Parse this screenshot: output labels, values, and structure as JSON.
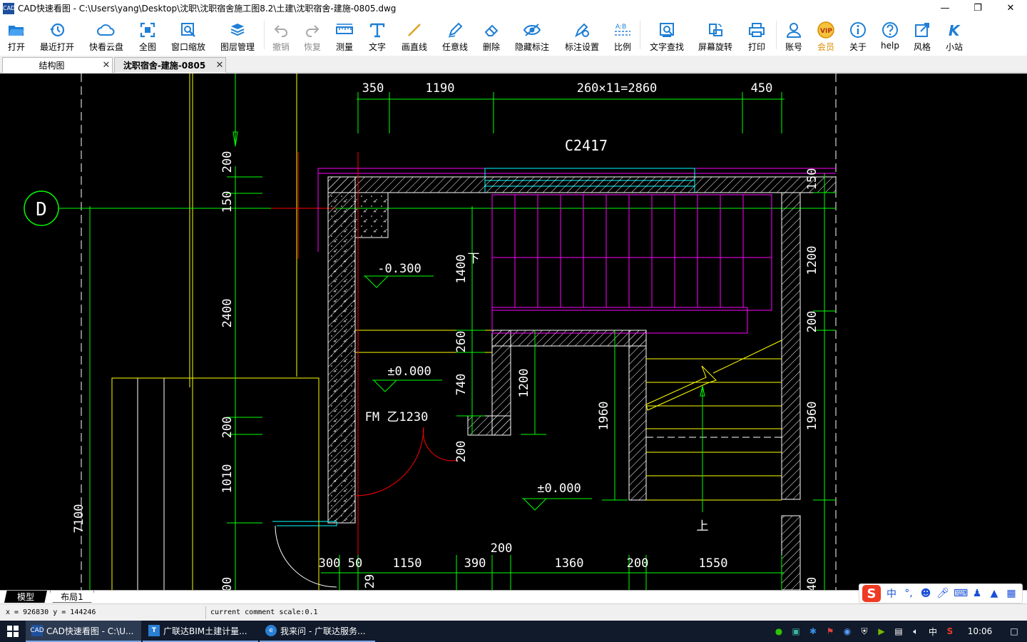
{
  "window": {
    "title": "CAD快速看图 - C:\\Users\\yang\\Desktop\\沈职\\沈职宿舍施工图8.2\\土建\\沈职宿舍-建施-0805.dwg",
    "icon": "cad-app-icon"
  },
  "toolbar": [
    {
      "label": "打开",
      "icon": "folder-open-icon"
    },
    {
      "label": "最近打开",
      "icon": "history-icon"
    },
    {
      "label": "快看云盘",
      "icon": "cloud-icon"
    },
    {
      "label": "全图",
      "icon": "fit-all-icon"
    },
    {
      "label": "窗口缩放",
      "icon": "zoom-window-icon"
    },
    {
      "label": "图层管理",
      "icon": "layers-icon"
    },
    {
      "label": "撤销",
      "icon": "undo-icon",
      "disabled": true
    },
    {
      "label": "恢复",
      "icon": "redo-icon",
      "disabled": true
    },
    {
      "label": "测量",
      "icon": "ruler-icon"
    },
    {
      "label": "文字",
      "icon": "text-icon"
    },
    {
      "label": "画直线",
      "icon": "line-icon"
    },
    {
      "label": "任意线",
      "icon": "pen-icon"
    },
    {
      "label": "删除",
      "icon": "eraser-icon"
    },
    {
      "label": "隐藏标注",
      "icon": "eye-hide-icon"
    },
    {
      "label": "标注设置",
      "icon": "annotation-settings-icon"
    },
    {
      "label": "比例",
      "icon": "scale-icon"
    },
    {
      "label": "文字查找",
      "icon": "text-search-icon"
    },
    {
      "label": "屏幕旋转",
      "icon": "rotate-screen-icon"
    },
    {
      "label": "打印",
      "icon": "printer-icon"
    },
    {
      "label": "账号",
      "icon": "user-icon"
    },
    {
      "label": "会员",
      "icon": "vip-icon"
    },
    {
      "label": "关于",
      "icon": "info-icon"
    },
    {
      "label": "help",
      "icon": "help-icon"
    },
    {
      "label": "风格",
      "icon": "style-icon"
    },
    {
      "label": "小站",
      "icon": "station-icon"
    }
  ],
  "tabs": [
    {
      "label": "结构图",
      "active": false
    },
    {
      "label": "沈职宿舍-建施-0805",
      "active": true
    }
  ],
  "drawing": {
    "top_dims": [
      "350",
      "1190",
      "260×11=2860",
      "450"
    ],
    "window_tag": "C2417",
    "axis_label": "D",
    "left_dims": [
      "200",
      "150",
      "2400",
      "200",
      "1010",
      "7100",
      "00"
    ],
    "elev1": "-0.300",
    "elev2": "±0.000",
    "elev3": "±0.000",
    "door_tag": "FM 乙1230",
    "inner_dims": [
      "1400",
      "260",
      "740",
      "1200",
      "1960",
      "200"
    ],
    "right_dims": [
      "150",
      "1200",
      "200",
      "1960",
      "40"
    ],
    "bottom_dims": [
      "300",
      "50",
      "1150",
      "390",
      "200",
      "1360",
      "200",
      "1550",
      "29"
    ],
    "stair_up_top": "下",
    "stair_up_bottom": "上"
  },
  "layout_tabs": [
    {
      "label": "模型",
      "active": true
    },
    {
      "label": "布局1",
      "active": false
    }
  ],
  "ime": {
    "lang": "中",
    "punct": "°,"
  },
  "status": {
    "coords": "x = 926830 y = 144246",
    "scale": "current comment scale:0.1"
  },
  "taskbar": {
    "apps": [
      {
        "label": "CAD快速看图 - C:\\U...",
        "active": true
      },
      {
        "label": "广联达BIM土建计量...",
        "active": false
      },
      {
        "label": "我来问 - 广联达服务...",
        "active": false
      }
    ],
    "tray_lang": "中",
    "clock": "10:06"
  },
  "colors": {
    "canvas": "#000000",
    "dim_green": "#00ff00",
    "wall_white": "#ffffff",
    "window_magenta": "#ff00ff",
    "window_cyan": "#00ffff",
    "stair_yellow": "#ffff00",
    "axis_red": "#ff0000",
    "toolbar_blue": "#1e7fd6",
    "vip_orange": "#d98c00"
  }
}
